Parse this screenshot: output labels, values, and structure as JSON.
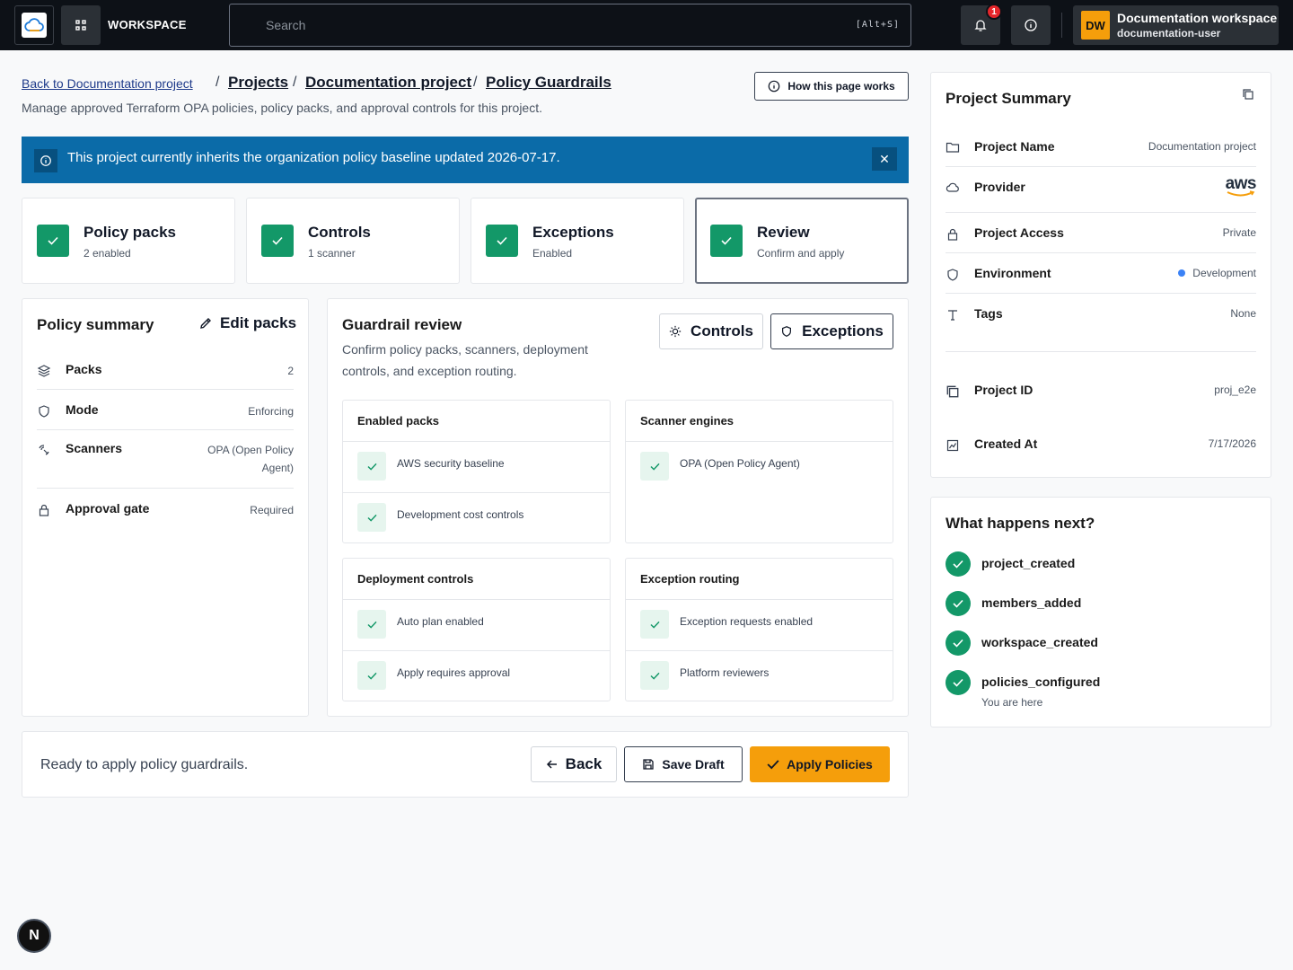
{
  "topbar": {
    "workspace_label": "WORKSPACE",
    "search_placeholder": "Search",
    "search_shortcut": "[Alt+S]",
    "notification_count": "1",
    "user_workspace": "Documentation workspace",
    "user_name": "documentation-user",
    "avatar_initials": "DW"
  },
  "breadcrumb": {
    "back": "Back to Documentation project",
    "items": [
      "Projects",
      "Documentation project",
      "Policy Guardrails"
    ],
    "separator": "/"
  },
  "page": {
    "description": "Manage approved Terraform OPA policies, policy packs, and approval controls for this project.",
    "how_button": "How this page works"
  },
  "banner": {
    "text": "This project currently inherits the organization policy baseline updated 2026-07-17.",
    "close": "✕"
  },
  "steps": [
    {
      "title": "Policy packs",
      "subtitle": "2 enabled"
    },
    {
      "title": "Controls",
      "subtitle": "1 scanner"
    },
    {
      "title": "Exceptions",
      "subtitle": "Enabled"
    },
    {
      "title": "Review",
      "subtitle": "Confirm and apply"
    }
  ],
  "policy_summary": {
    "title": "Policy summary",
    "edit": "Edit packs",
    "rows": [
      {
        "label": "Packs",
        "value": "2"
      },
      {
        "label": "Mode",
        "value": "Enforcing"
      },
      {
        "label": "Scanners",
        "value": "OPA (Open Policy Agent)"
      },
      {
        "label": "Approval gate",
        "value": "Required"
      }
    ]
  },
  "guardrail": {
    "title": "Guardrail review",
    "description": "Confirm policy packs, scanners, deployment controls, and exception routing.",
    "controls_btn": "Controls",
    "exceptions_btn": "Exceptions",
    "enabled_packs": {
      "title": "Enabled packs",
      "items": [
        "AWS security baseline",
        "Development cost controls"
      ]
    },
    "scanner_engines": {
      "title": "Scanner engines",
      "items": [
        "OPA (Open Policy Agent)"
      ]
    },
    "deployment_controls": {
      "title": "Deployment controls",
      "items": [
        "Auto plan enabled",
        "Apply requires approval"
      ]
    },
    "exception_routing": {
      "title": "Exception routing",
      "items": [
        "Exception requests enabled",
        "Platform reviewers"
      ]
    }
  },
  "footer": {
    "status": "Ready to apply policy guardrails.",
    "back": "Back",
    "save": "Save Draft",
    "apply": "Apply Policies"
  },
  "project_summary": {
    "title": "Project Summary",
    "rows": [
      {
        "label": "Project Name",
        "value": "Documentation project"
      },
      {
        "label": "Provider",
        "value": "aws"
      },
      {
        "label": "Project Access",
        "value": "Private"
      },
      {
        "label": "Environment",
        "value": "Development"
      },
      {
        "label": "Tags",
        "value": "None"
      },
      {
        "label": "Project ID",
        "value": "proj_e2e"
      },
      {
        "label": "Created At",
        "value": "7/17/2026"
      }
    ]
  },
  "next": {
    "title": "What happens next?",
    "items": [
      "project_created",
      "members_added",
      "workspace_created",
      "policies_configured"
    ],
    "current_note": "You are here"
  },
  "dev_badge": "N",
  "colors": {
    "accent": "#f59e0b",
    "success": "#139868",
    "banner": "#0b6ba8",
    "topbar": "#0d1117"
  }
}
